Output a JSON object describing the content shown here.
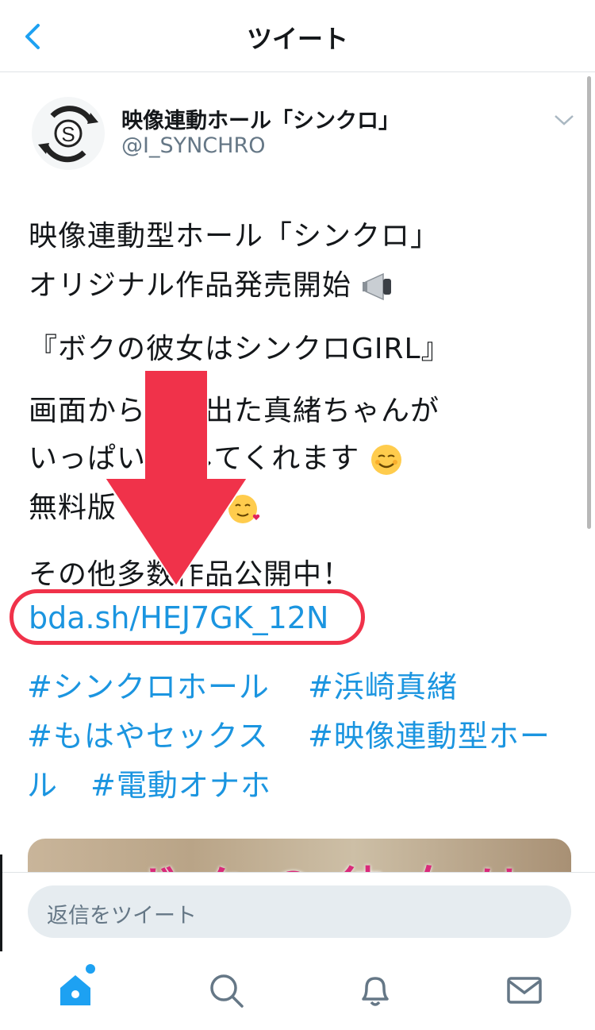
{
  "header": {
    "title": "ツイート"
  },
  "tweet": {
    "display_name": "映像連動ホール「シンクロ」",
    "handle": "@I_SYNCHRO",
    "lines": [
      "映像連動型ホール「シンクロ」",
      "オリジナル作品発売開始",
      "『ボクの彼女はシンクロGIRL』",
      "画面から飛び出た真緒ちゃんが",
      "いっぱい 　してくれます",
      "無料版",
      "その他多数作品公開中！"
    ],
    "link": "bda.sh/HEJ7GK_12N",
    "hashtags": [
      "#シンクロホール",
      "#浜崎真緒",
      "#もはやセックス",
      "#映像連動型ホー",
      "ル",
      "#電動オナホ"
    ]
  },
  "composer": {
    "placeholder": "返信をツイート"
  },
  "colors": {
    "link": "#1b95e0",
    "accent": "#1da1f2",
    "highlight": "#f0324a"
  },
  "icons": [
    "back-chevron-icon",
    "chevron-down-icon",
    "megaphone-emoji",
    "smiling-emoji",
    "heart-face-emoji",
    "home-icon",
    "search-icon",
    "bell-icon",
    "mail-icon"
  ]
}
